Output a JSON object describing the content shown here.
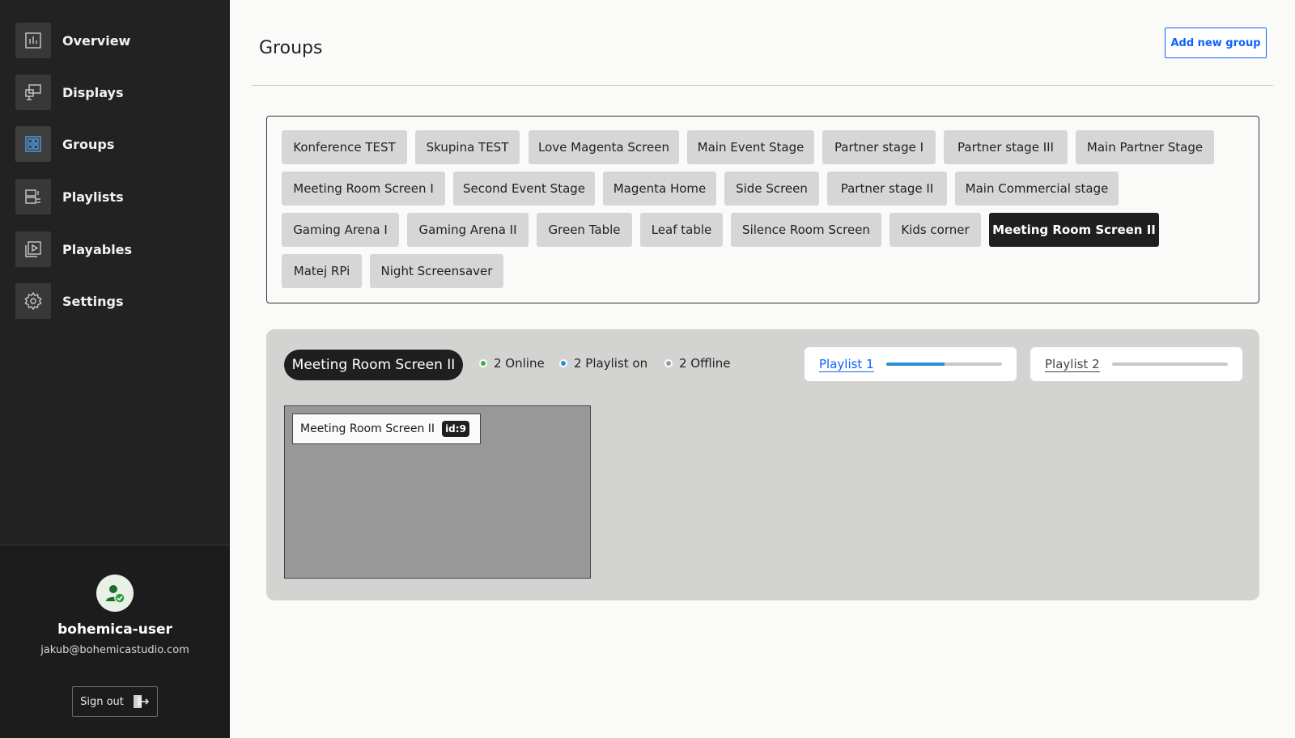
{
  "sidebar": {
    "nav": [
      {
        "label": "Overview",
        "icon": "chart-icon"
      },
      {
        "label": "Displays",
        "icon": "displays-icon"
      },
      {
        "label": "Groups",
        "icon": "groups-icon",
        "active": true
      },
      {
        "label": "Playlists",
        "icon": "playlists-icon"
      },
      {
        "label": "Playables",
        "icon": "playables-icon"
      },
      {
        "label": "Settings",
        "icon": "gear-icon"
      }
    ],
    "user": {
      "name": "bohemica-user",
      "email": "jakub@bohemicastudio.com",
      "sign_out": "Sign out"
    }
  },
  "header": {
    "title": "Groups",
    "add_button": "Add new group"
  },
  "groups": [
    "Konference TEST",
    "Skupina TEST",
    "Love Magenta Screen",
    "Main Event Stage",
    "Partner stage I",
    "Partner stage III",
    "Main Partner Stage",
    "Meeting Room Screen I",
    "Second Event Stage",
    "Magenta Home",
    "Side Screen",
    "Partner stage II",
    "Main Commercial stage",
    "Gaming Arena I",
    "Gaming Arena II",
    "Green Table",
    "Leaf table",
    "Silence Room Screen",
    "Kids corner",
    "Meeting Room Screen II",
    "Matej RPi",
    "Night Screensaver"
  ],
  "selected_group": "Meeting Room Screen II",
  "detail": {
    "group_name": "Meeting Room Screen II",
    "stats": [
      {
        "label": "2 Online",
        "color": "#3fae3f"
      },
      {
        "label": "2 Playlist on",
        "color": "#2d8fd5"
      },
      {
        "label": "2 Offline",
        "color": "#9a9a9a"
      }
    ],
    "playlists": [
      {
        "label": "Playlist 1",
        "progress": 0.5,
        "color": "#0f62fe"
      },
      {
        "label": "Playlist 2",
        "progress": 0,
        "color": "#444444"
      }
    ],
    "screen": {
      "name": "Meeting Room Screen II",
      "id": "id:9"
    }
  }
}
